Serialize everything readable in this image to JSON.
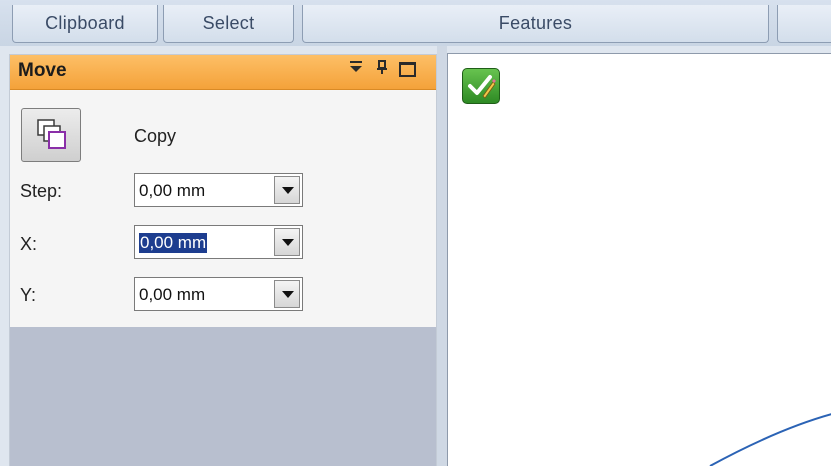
{
  "ribbon": {
    "groups": [
      "Clipboard",
      "Select",
      "Features",
      ""
    ]
  },
  "panel": {
    "title": "Move",
    "header_icons": [
      "dropdown-arrow-icon",
      "pin-icon",
      "maximize-icon"
    ],
    "copy_label": "Copy",
    "fields": [
      {
        "label": "Step:",
        "value": "0,00 mm",
        "selected": false
      },
      {
        "label": "X:",
        "value": "0,00 mm",
        "selected": true
      },
      {
        "label": "Y:",
        "value": "0,00 mm",
        "selected": false
      }
    ]
  },
  "canvas": {
    "icon": "check-edit-icon"
  },
  "colors": {
    "panel_header": "#f4a23a",
    "selection": "#1d3d8f",
    "arc": "#2b63b5"
  }
}
